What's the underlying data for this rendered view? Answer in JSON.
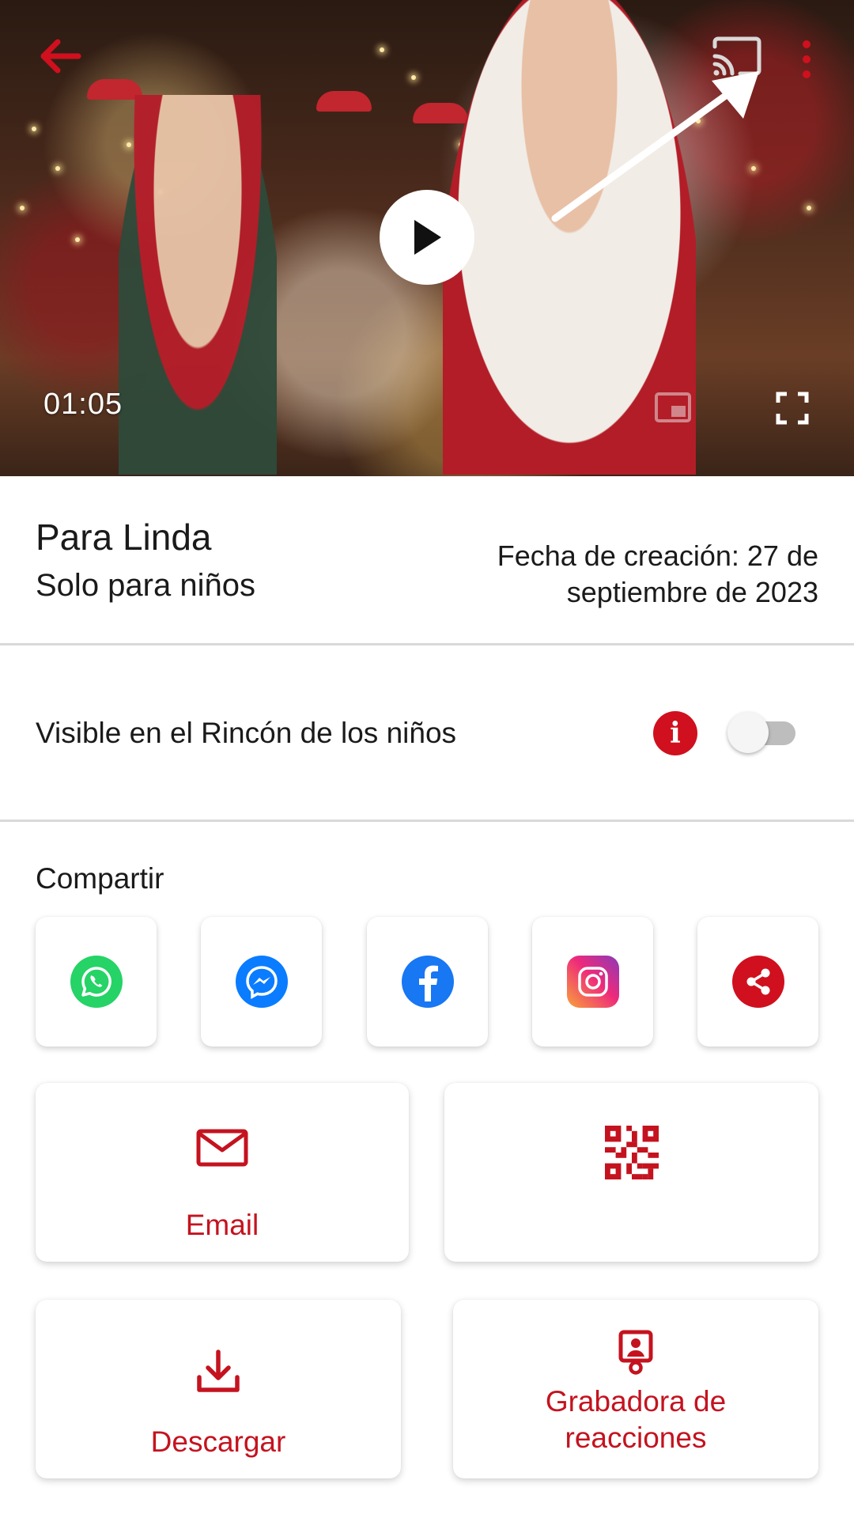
{
  "video": {
    "time": "01:05"
  },
  "details": {
    "title": "Para Linda",
    "subtitle": "Solo para  niños",
    "created_line1": "Fecha de creación: 27 de",
    "created_line2": "septiembre de 2023"
  },
  "visibility": {
    "label": "Visible en el Rincón de los niños",
    "info_glyph": "i",
    "enabled": false
  },
  "share": {
    "title": "Compartir",
    "apps": [
      "whatsapp-icon",
      "messenger-icon",
      "facebook-icon",
      "instagram-icon",
      "share-icon"
    ]
  },
  "actions": {
    "email_label": "Email",
    "download_label": "Descargar",
    "recorder_line1": "Grabadora de",
    "recorder_line2": "reacciones"
  },
  "colors": {
    "accent": "#d0101e",
    "whatsapp": "#25d366",
    "messenger": "#0a7cff",
    "facebook": "#1877f2"
  }
}
